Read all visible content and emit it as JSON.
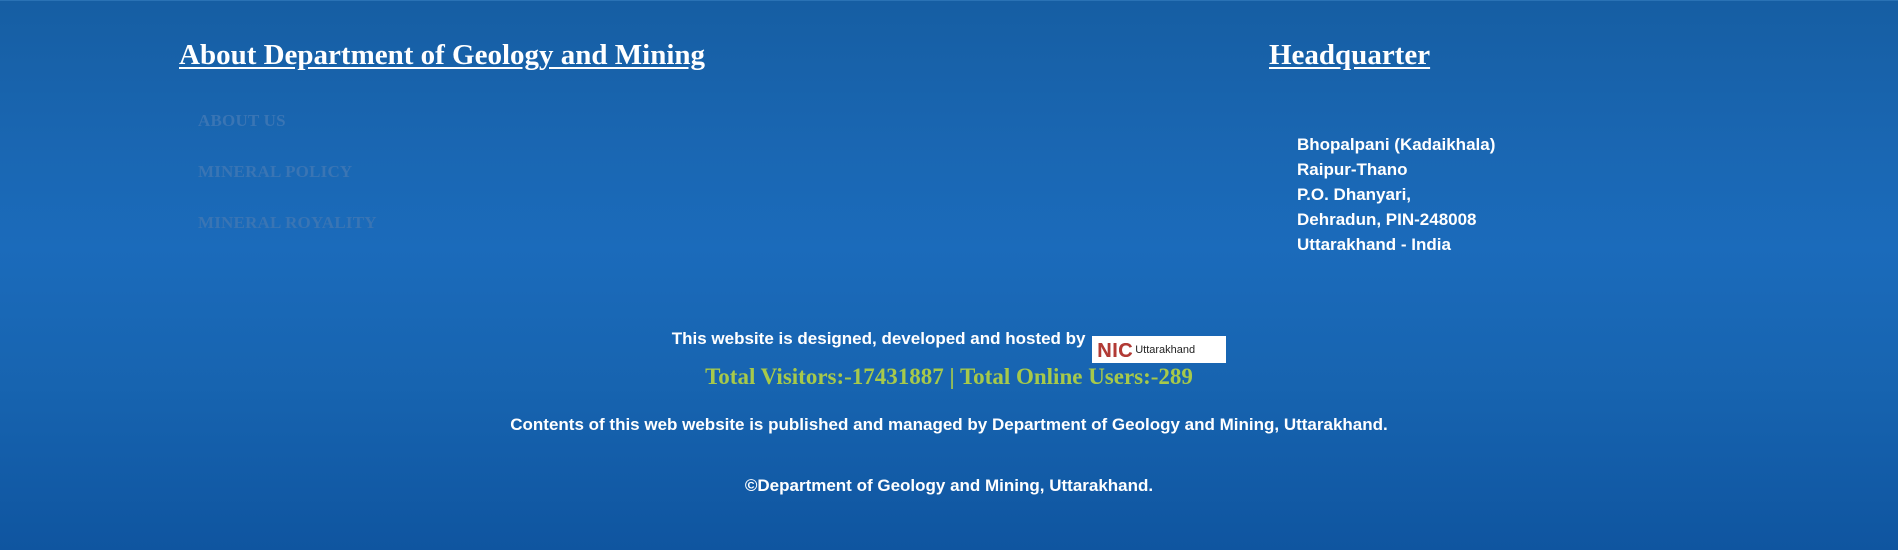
{
  "about": {
    "heading": "About Department of Geology and Mining",
    "links": [
      {
        "label": "ABOUT US"
      },
      {
        "label": "MINERAL POLICY"
      },
      {
        "label": "MINERAL ROYALITY"
      }
    ]
  },
  "headquarter": {
    "heading": "Headquarter",
    "address": [
      "Bhopalpani (Kadaikhala)",
      "Raipur-Thano",
      "P.O. Dhanyari,",
      "Dehradun, PIN-248008",
      "Uttarakhand - India"
    ]
  },
  "credits": {
    "designed_text": "This website is designed, developed and hosted by",
    "logo_nic": "NIC",
    "logo_state": "Uttarakhand",
    "logo_alt": "NIC Uttarakhand"
  },
  "stats": {
    "visitors_line": "Total Visitors:-17431887 | Total Online Users:-289",
    "visitor_color": "#a7c94a"
  },
  "footer": {
    "managed_text": "Contents of this web website is published and managed by Department of Geology and Mining, Uttarakhand.",
    "copyright_text": "©Department of Geology and Mining, Uttarakhand."
  },
  "colors": {
    "background": "#1a67b3",
    "link_muted": "#3a75b4",
    "text": "#ffffff"
  }
}
